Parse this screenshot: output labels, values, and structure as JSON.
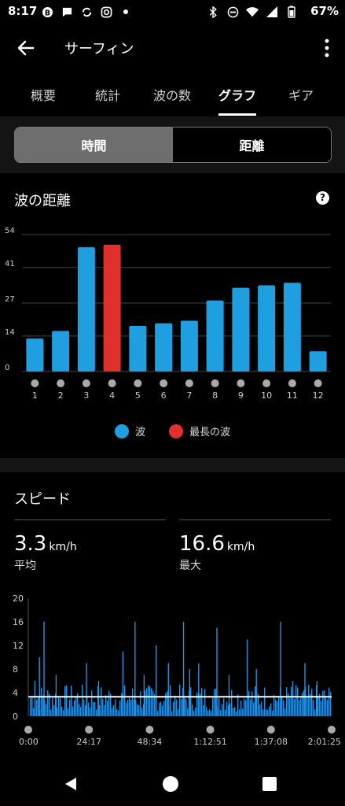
{
  "status": {
    "time": "8:17",
    "battery": "67%"
  },
  "header": {
    "title": "サーフィン"
  },
  "tabs": [
    "概要",
    "統計",
    "波の数",
    "グラフ",
    "ギア"
  ],
  "active_tab": 3,
  "toggle": {
    "selected": "時間",
    "other": "距離"
  },
  "waves_card": {
    "title": "波の距離",
    "help": "?"
  },
  "speed_card": {
    "title": "スピード",
    "avg_value": "3.3",
    "avg_unit": "km/h",
    "avg_label": "平均",
    "max_value": "16.6",
    "max_unit": "km/h",
    "max_label": "最大"
  },
  "colors": {
    "wave_blue": "#1f9fe0",
    "longest_red": "#e0302c",
    "speed_blue": "#2a8fd8",
    "avg_line": "#ffffff"
  },
  "icons": [
    "back-arrow-icon",
    "more-vert-icon",
    "help-icon",
    "nav-back-icon",
    "nav-home-icon",
    "nav-recents-icon"
  ],
  "chart_data": [
    {
      "type": "bar",
      "title": "波の距離",
      "categories": [
        "1",
        "2",
        "3",
        "4",
        "5",
        "6",
        "7",
        "8",
        "9",
        "10",
        "11",
        "12"
      ],
      "values": [
        13,
        16,
        49,
        50,
        18,
        19,
        20,
        28,
        33,
        34,
        35,
        8
      ],
      "highlight_index": 3,
      "yticks": [
        "54",
        "41",
        "27",
        "14",
        "0"
      ],
      "ylim": [
        0,
        54
      ],
      "grid": true,
      "legend": {
        "position": "bottom",
        "items": [
          {
            "label": "波",
            "color": "#1f9fe0"
          },
          {
            "label": "最長の波",
            "color": "#e0302c"
          }
        ]
      }
    },
    {
      "type": "area",
      "title": "スピード",
      "yticks": [
        "20",
        "16",
        "12",
        "8",
        "4",
        "0"
      ],
      "ylim": [
        0,
        20
      ],
      "xticks": [
        "0:00",
        "24:17",
        "48:34",
        "1:12:51",
        "1:37:08",
        "2:01:25"
      ],
      "average": 3.3,
      "max": 16.6,
      "spikes": [
        {
          "t": 0.02,
          "v": 6
        },
        {
          "t": 0.035,
          "v": 10
        },
        {
          "t": 0.05,
          "v": 16
        },
        {
          "t": 0.09,
          "v": 7
        },
        {
          "t": 0.12,
          "v": 5
        },
        {
          "t": 0.19,
          "v": 9
        },
        {
          "t": 0.23,
          "v": 6
        },
        {
          "t": 0.31,
          "v": 11
        },
        {
          "t": 0.35,
          "v": 16
        },
        {
          "t": 0.38,
          "v": 7
        },
        {
          "t": 0.42,
          "v": 12
        },
        {
          "t": 0.46,
          "v": 9
        },
        {
          "t": 0.51,
          "v": 16
        },
        {
          "t": 0.53,
          "v": 8
        },
        {
          "t": 0.56,
          "v": 9
        },
        {
          "t": 0.62,
          "v": 15
        },
        {
          "t": 0.66,
          "v": 7
        },
        {
          "t": 0.72,
          "v": 13
        },
        {
          "t": 0.75,
          "v": 8
        },
        {
          "t": 0.83,
          "v": 16
        },
        {
          "t": 0.87,
          "v": 6
        },
        {
          "t": 0.91,
          "v": 9
        },
        {
          "t": 0.95,
          "v": 6
        }
      ]
    }
  ]
}
